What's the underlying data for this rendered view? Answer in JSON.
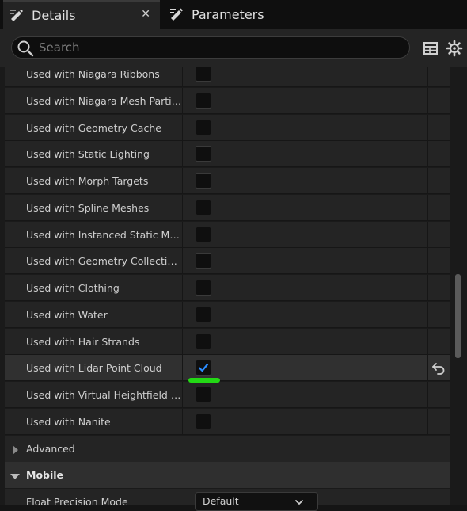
{
  "tabs": [
    {
      "label": "Details",
      "active": true,
      "icon": "pencil-icon",
      "close": "✕"
    },
    {
      "label": "Parameters",
      "active": false,
      "icon": "pencil-icon"
    }
  ],
  "search": {
    "placeholder": "Search",
    "value": ""
  },
  "toolbar": {
    "icons": [
      "table-view-icon",
      "gear-icon"
    ]
  },
  "properties": [
    {
      "label": "Used with Niagara Ribbons",
      "checked": false
    },
    {
      "label": "Used with Niagara Mesh Particles",
      "checked": false
    },
    {
      "label": "Used with Geometry Cache",
      "checked": false
    },
    {
      "label": "Used with Static Lighting",
      "checked": false
    },
    {
      "label": "Used with Morph Targets",
      "checked": false
    },
    {
      "label": "Used with Spline Meshes",
      "checked": false
    },
    {
      "label": "Used with Instanced Static Mes...",
      "checked": false
    },
    {
      "label": "Used with Geometry Collections",
      "checked": false
    },
    {
      "label": "Used with Clothing",
      "checked": false
    },
    {
      "label": "Used with Water",
      "checked": false
    },
    {
      "label": "Used with Hair Strands",
      "checked": false
    },
    {
      "label": "Used with Lidar Point Cloud",
      "checked": true,
      "reset_icon": "reset-arrow-icon"
    },
    {
      "label": "Used with Virtual Heightfield Mesh",
      "checked": false
    },
    {
      "label": "Used with Nanite",
      "checked": false
    }
  ],
  "sections": [
    {
      "label": "Advanced",
      "expanded": false
    },
    {
      "label": "Mobile",
      "expanded": true
    }
  ],
  "mobile_props": [
    {
      "label": "Float Precision Mode",
      "value": "Default"
    }
  ],
  "colors": {
    "check": "#2b8cff",
    "highlight_mark": "#23d915",
    "panel_bg": "#242424"
  }
}
